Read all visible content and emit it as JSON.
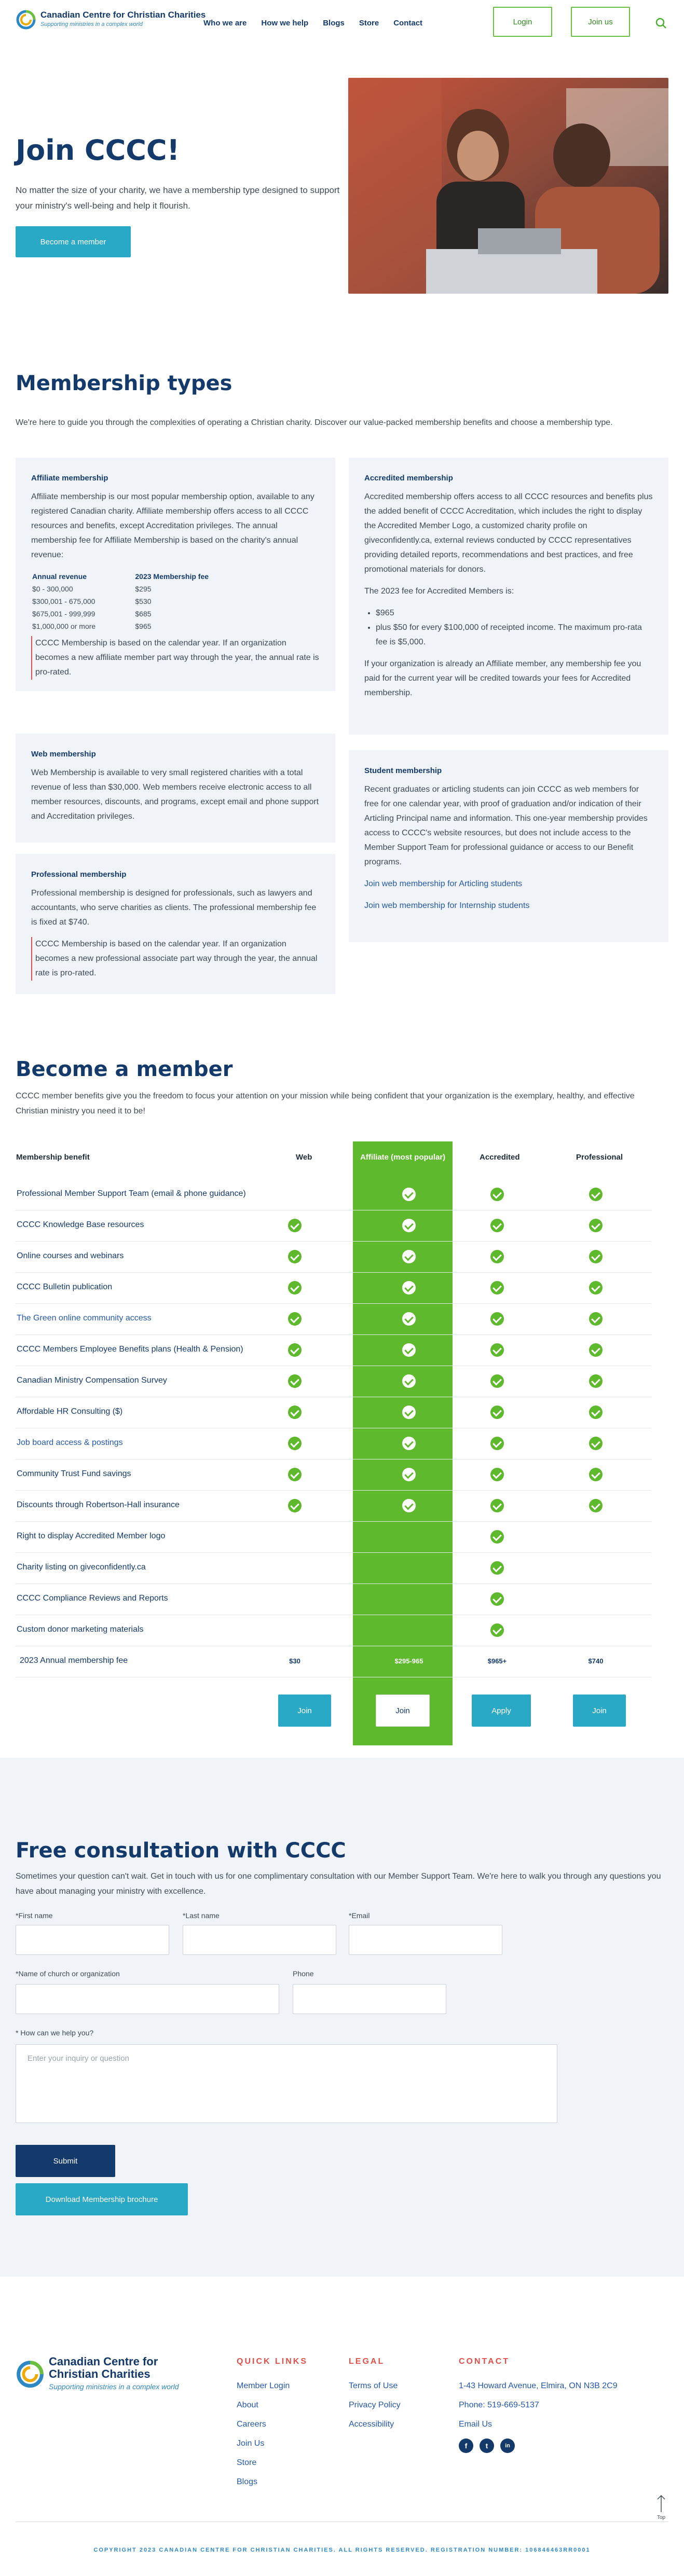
{
  "header": {
    "logo": {
      "name": "Canadian Centre for Christian Charities",
      "tagline": "Supporting ministries in a complex world"
    },
    "nav": [
      "Who we are",
      "How we help",
      "Blogs",
      "Store",
      "Contact"
    ],
    "login": "Login",
    "join": "Join us"
  },
  "hero": {
    "title": "Join CCCC!",
    "text": "No matter the size of your charity, we have a membership type designed to support your ministry's well-being and help it flourish.",
    "cta": "Become a member"
  },
  "types": {
    "title": "Membership types",
    "lead": "We're here to guide you through the complexities of operating a Christian charity. Discover our value-packed membership benefits and choose a membership type.",
    "affiliate": {
      "title": "Affiliate membership",
      "text": "Affiliate membership is our most popular membership option, available to any registered Canadian charity. Affiliate membership offers access to all CCCC resources and benefits, except Accreditation privileges. The annual membership fee for Affiliate Membership is based on the charity's annual revenue:",
      "col1": "Annual revenue",
      "col2": "2023 Membership fee",
      "rows": [
        [
          "$0 - 300,000",
          "$295"
        ],
        [
          "$300,001 - 675,000",
          "$530"
        ],
        [
          "$675,001 - 999,999",
          "$685"
        ],
        [
          "$1,000,000 or more",
          "$965"
        ]
      ],
      "note": "CCCC Membership is based on the calendar year. If an organization becomes a new affiliate member part way through the year, the annual rate is pro-rated."
    },
    "accredited": {
      "title": "Accredited membership",
      "text": "Accredited membership offers access to all CCCC resources and benefits plus the added benefit of CCCC Accreditation, which includes the right to display the Accredited Member Logo, a customized charity profile on giveconfidently.ca, external reviews conducted by CCCC representatives providing detailed reports, recommendations and best practices, and free promotional materials for donors.",
      "fee_intro": "The 2023 fee for Accredited Members is:",
      "bullets": [
        "$965",
        "plus $50 for every $100,000 of receipted income. The maximum pro-rata fee is $5,000."
      ],
      "note": "If your organization is already an Affiliate member, any membership fee you paid for the current year will be credited towards your fees for Accredited membership."
    },
    "web": {
      "title": "Web membership",
      "text": "Web Membership is available to very small registered charities with a total revenue of less than $30,000. Web members receive electronic access to all member resources, discounts, and programs, except email and phone support and Accreditation privileges."
    },
    "student": {
      "title": "Student membership",
      "text": "Recent graduates or articling students can join CCCC as web members for free for one calendar year, with proof of graduation and/or indication of their Articling Principal name and information. This one-year membership provides access to CCCC's website resources, but does not include access to the Member Support Team for professional guidance or access to our Benefit programs.",
      "link1": "Join web membership for Articling students",
      "link2": "Join web membership for Internship students"
    },
    "professional": {
      "title": "Professional membership",
      "text": "Professional membership is designed for professionals, such as lawyers and accountants, who serve charities as clients. The professional membership fee is fixed at $740.",
      "note": "CCCC Membership is based on the calendar year. If an organization becomes a new professional associate part way through the year, the annual rate is pro-rated."
    }
  },
  "become": {
    "title": "Become a member",
    "lead": "CCCC member benefits give you the freedom to focus your attention on your mission while being confident that your organization is the exemplary, healthy, and effective Christian ministry you need it to be!",
    "headers": [
      "Membership benefit",
      "Web",
      "Affiliate (most popular)",
      "Accredited",
      "Professional"
    ],
    "rows": [
      {
        "label": "Professional Member Support Team (email & phone guidance)",
        "link": false,
        "checks": [
          false,
          true,
          true,
          true
        ]
      },
      {
        "label": "CCCC Knowledge Base resources",
        "link": false,
        "checks": [
          true,
          true,
          true,
          true
        ]
      },
      {
        "label": "Online courses and webinars",
        "link": false,
        "checks": [
          true,
          true,
          true,
          true
        ]
      },
      {
        "label": "CCCC Bulletin publication",
        "link": false,
        "checks": [
          true,
          true,
          true,
          true
        ]
      },
      {
        "label": "The Green online community access",
        "link": true,
        "checks": [
          true,
          true,
          true,
          true
        ]
      },
      {
        "label": "CCCC Members Employee Benefits plans (Health & Pension)",
        "link": false,
        "checks": [
          true,
          true,
          true,
          true
        ]
      },
      {
        "label": "Canadian Ministry Compensation Survey",
        "link": false,
        "checks": [
          true,
          true,
          true,
          true
        ]
      },
      {
        "label": "Affordable HR Consulting ($)",
        "link": false,
        "checks": [
          true,
          true,
          true,
          true
        ]
      },
      {
        "label": "Job board access & postings",
        "link": true,
        "checks": [
          true,
          true,
          true,
          true
        ]
      },
      {
        "label": "Community Trust Fund savings",
        "link": false,
        "checks": [
          true,
          true,
          true,
          true
        ]
      },
      {
        "label": "Discounts through Robertson-Hall insurance",
        "link": false,
        "checks": [
          true,
          true,
          true,
          true
        ]
      },
      {
        "label": "Right to display Accredited Member logo",
        "link": false,
        "checks": [
          false,
          false,
          true,
          false
        ]
      },
      {
        "label": "Charity listing on giveconfidently.ca",
        "link": false,
        "checks": [
          false,
          false,
          true,
          false
        ]
      },
      {
        "label": "CCCC Compliance Reviews and Reports",
        "link": false,
        "checks": [
          false,
          false,
          true,
          false
        ]
      },
      {
        "label": "Custom donor marketing materials",
        "link": false,
        "checks": [
          false,
          false,
          true,
          false
        ]
      }
    ],
    "fee_label": "2023 Annual membership fee",
    "fees": [
      "$30",
      "$295-965",
      "$965+",
      "$740"
    ],
    "buttons": [
      "Join",
      "Join",
      "Apply",
      "Join"
    ]
  },
  "consult": {
    "title": "Free consultation with CCCC",
    "lead": "Sometimes your question can't wait. Get in touch with us for one complimentary consultation with our Member Support Team. We're here to walk you through any questions you have about managing your ministry with excellence.",
    "first": "*First name",
    "last": "*Last name",
    "email": "*Email",
    "church": "*Name of church or organization",
    "phone": "Phone",
    "help": "* How can we help you?",
    "help_placeholder": "Enter your inquiry or question",
    "submit": "Submit",
    "brochure": "Download Membership brochure"
  },
  "footer": {
    "quick_title": "QUICK LINKS",
    "quick": [
      "Member Login",
      "About",
      "Careers",
      "Join Us",
      "Store",
      "Blogs"
    ],
    "legal_title": "LEGAL",
    "legal": [
      "Terms of Use",
      "Privacy Policy",
      "Accessibility"
    ],
    "contact_title": "CONTACT",
    "contact": [
      "1-43 Howard Avenue, Elmira, ON N3B 2C9",
      "Phone: 519-669-5137",
      "Email Us"
    ],
    "top": "Top",
    "copyright": "COPYRIGHT 2023 CANADIAN CENTRE FOR CHRISTIAN CHARITIES. ALL RIGHTS RESERVED. REGISTRATION NUMBER: 106846463RR0001"
  },
  "colors": {
    "navy": "#133a6b",
    "green": "#5fb92c",
    "teal": "#2aa9c7",
    "coral": "#e0504a",
    "panel": "#f0f3f7"
  }
}
